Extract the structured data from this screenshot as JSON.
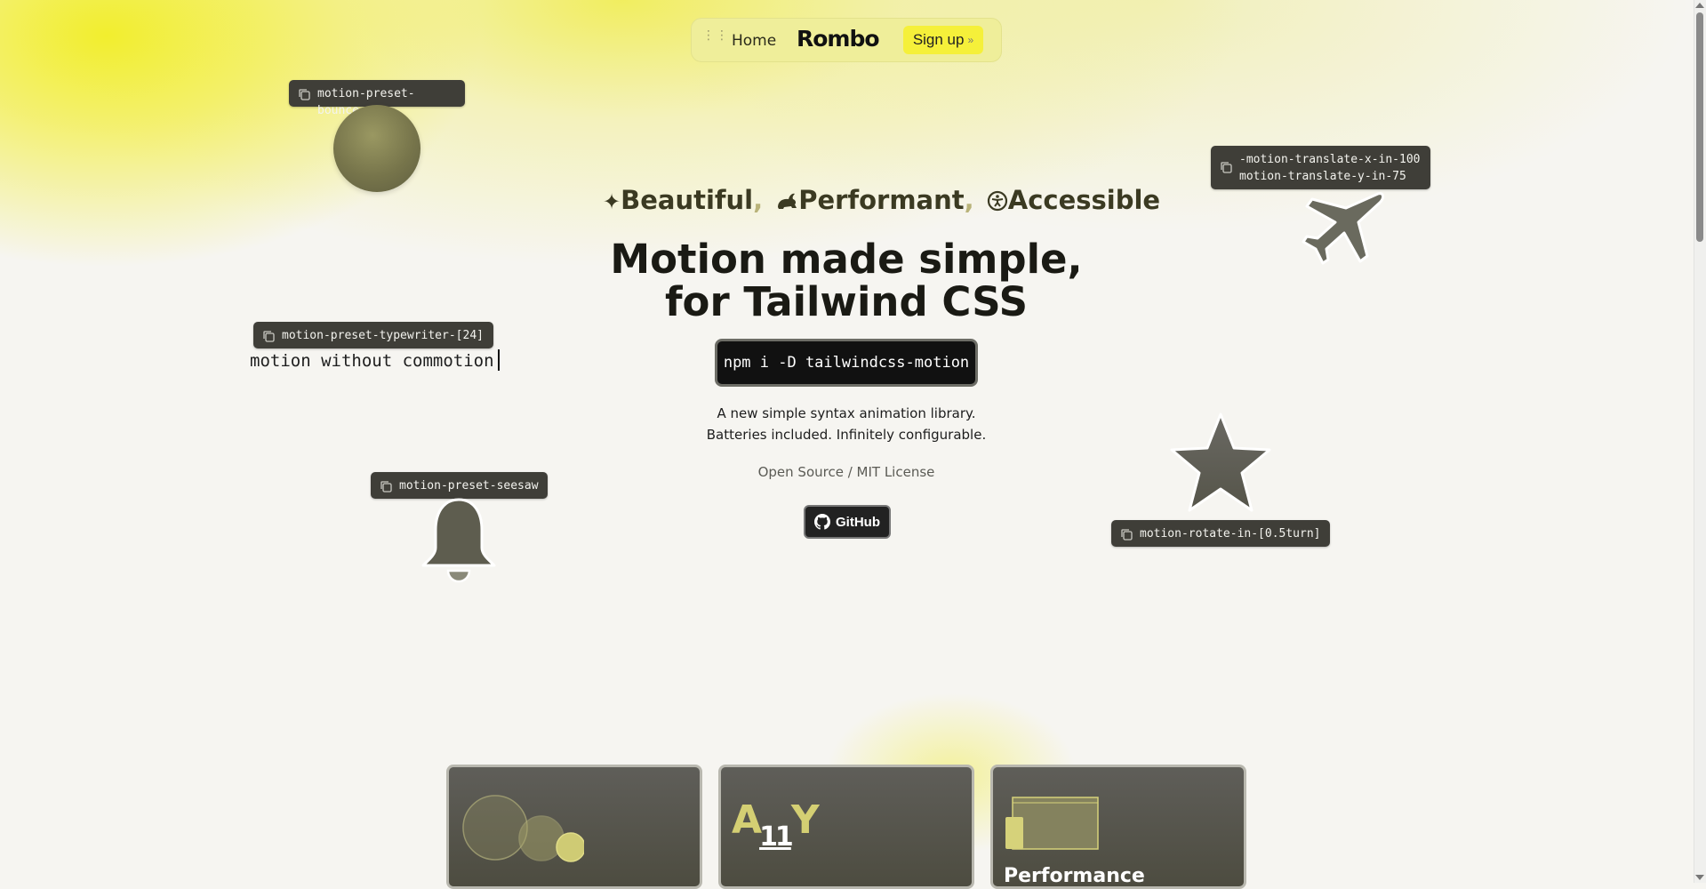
{
  "nav": {
    "home_label": "Home",
    "logo": "Rombo",
    "signup_label": "Sign up",
    "signup_chevron": "»"
  },
  "tags": {
    "bounce": "motion-preset-bounce",
    "translate_line1": "-motion-translate-x-in-100",
    "translate_line2": "motion-translate-y-in-75",
    "typewriter": "motion-preset-typewriter-[24]",
    "seesaw": "motion-preset-seesaw",
    "rotate": "motion-rotate-in-[0.5turn]"
  },
  "typewriter_text": "motion without commotion",
  "tagline": {
    "item1": "Beautiful",
    "item2": "Performant",
    "item3": "Accessible",
    "comma": ","
  },
  "hero": {
    "headline_line1": "Motion made simple,",
    "headline_line2": "for Tailwind CSS",
    "install_command": "npm i -D tailwindcss-motion",
    "desc_line1": "A new simple syntax animation library.",
    "desc_line2": "Batteries included. Infinitely configurable.",
    "license": "Open Source / MIT License",
    "github_label": "GitHub"
  },
  "cards": {
    "a11y_a": "A",
    "a11y_11": "11",
    "a11y_y": "Y",
    "performance_title": "Performance"
  },
  "colors": {
    "accent_yellow": "#f5f03a",
    "nav_bg": "#efee9a",
    "tag_bg": "#3f3e38",
    "icon_gray": "#6a6a5e"
  },
  "icons": [
    "grip-icon",
    "copy-icon",
    "sparkle-icon",
    "rabbit-icon",
    "accessibility-icon",
    "plane-icon",
    "bell-icon",
    "star-icon",
    "github-icon"
  ]
}
